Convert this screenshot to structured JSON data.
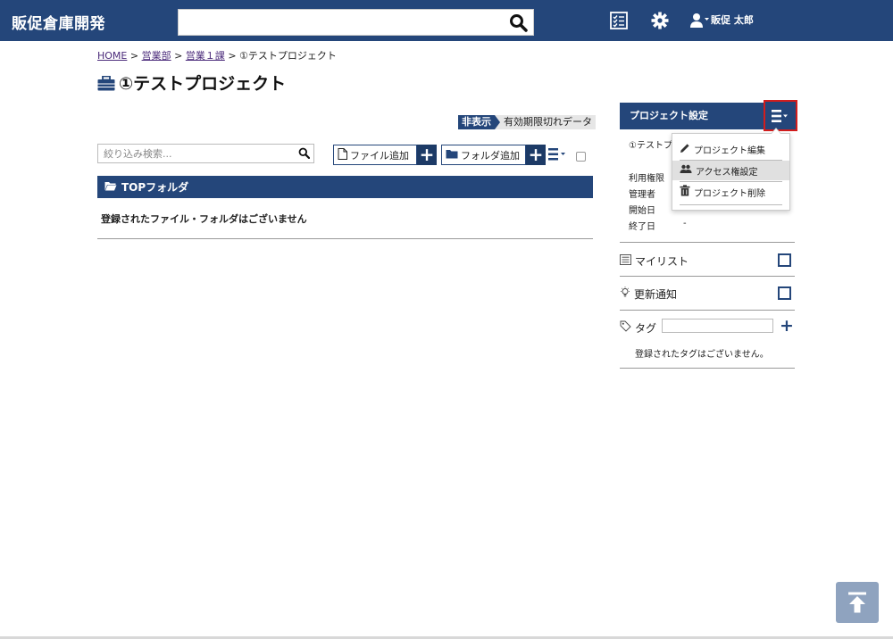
{
  "header": {
    "brand": "販促倉庫開発",
    "search_value": "",
    "user_name": "販促 太郎",
    "icons": [
      "search-icon",
      "checklist-icon",
      "gear-icon",
      "user-icon"
    ]
  },
  "breadcrumb": {
    "items": [
      "HOME",
      "営業部",
      "営業１課"
    ],
    "separator": ">",
    "current": "①テストプロジェクト"
  },
  "page": {
    "title": "①テストプロジェクト",
    "title_icon": "briefcase-icon"
  },
  "visibility_badge": {
    "label": "非表示",
    "value": "有効期限切れデータ"
  },
  "toolbar": {
    "filter_placeholder": "絞り込み検索...",
    "add_file_label": "ファイル追加",
    "add_folder_label": "フォルダ追加",
    "plus_symbol": "+"
  },
  "folder": {
    "name": "TOPフォルダ",
    "empty_message": "登録されたファイル・フォルダはございません"
  },
  "project_panel": {
    "title": "プロジェクト設定",
    "project_name": "①テストプ",
    "info_rows": [
      {
        "label": "利用権限",
        "value": ""
      },
      {
        "label": "管理者",
        "value": ""
      },
      {
        "label": "開始日",
        "value": ""
      },
      {
        "label": "終了日",
        "value": "-"
      }
    ],
    "mylist_label": "マイリスト",
    "notify_label": "更新通知",
    "tag_label": "タグ",
    "tag_value": "",
    "tag_plus": "+",
    "tag_empty": "登録されたタグはございません。"
  },
  "dropdown": {
    "items": [
      {
        "label": "プロジェクト編集",
        "icon": "pencil-icon"
      },
      {
        "label": "アクセス権設定",
        "icon": "users-icon"
      },
      {
        "label": "プロジェクト削除",
        "icon": "trash-icon"
      }
    ]
  },
  "colors": {
    "primary": "#24467a",
    "highlight_border": "#d21d1d",
    "scroll_top_bg": "#8fa3bf"
  }
}
